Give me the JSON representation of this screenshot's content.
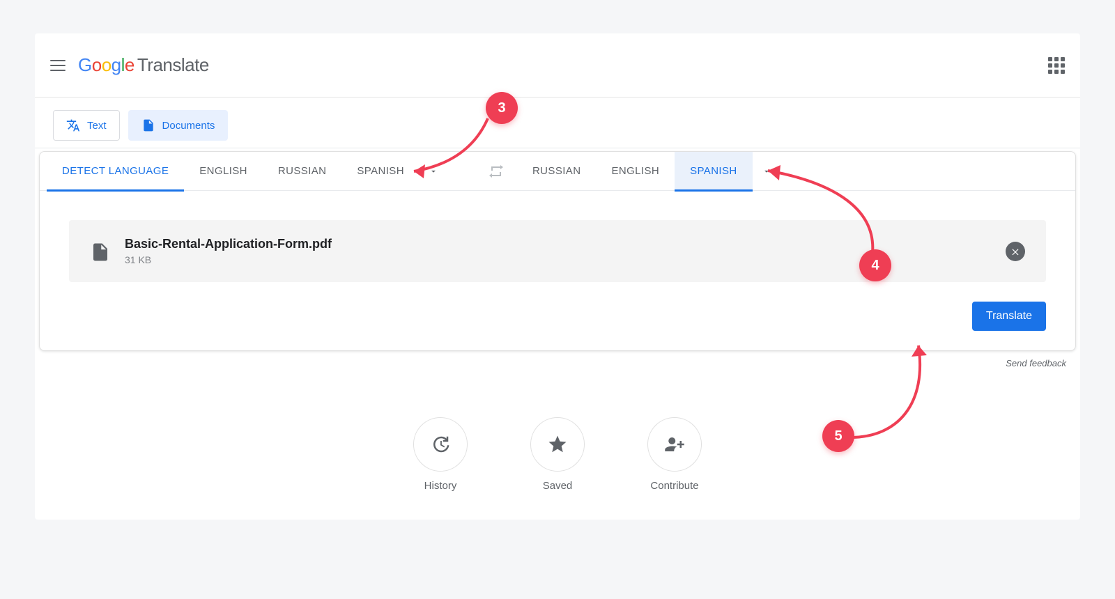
{
  "header": {
    "logo_translate": "Translate"
  },
  "modes": {
    "text": "Text",
    "documents": "Documents"
  },
  "source_langs": {
    "detect": "DETECT LANGUAGE",
    "items": [
      "ENGLISH",
      "RUSSIAN",
      "SPANISH"
    ]
  },
  "target_langs": {
    "items": [
      "RUSSIAN",
      "ENGLISH",
      "SPANISH"
    ]
  },
  "file": {
    "name": "Basic-Rental-Application-Form.pdf",
    "size": "31 KB"
  },
  "actions": {
    "translate": "Translate",
    "feedback": "Send feedback"
  },
  "footer": {
    "history": "History",
    "saved": "Saved",
    "contribute": "Contribute"
  },
  "annotations": {
    "b3": "3",
    "b4": "4",
    "b5": "5"
  }
}
